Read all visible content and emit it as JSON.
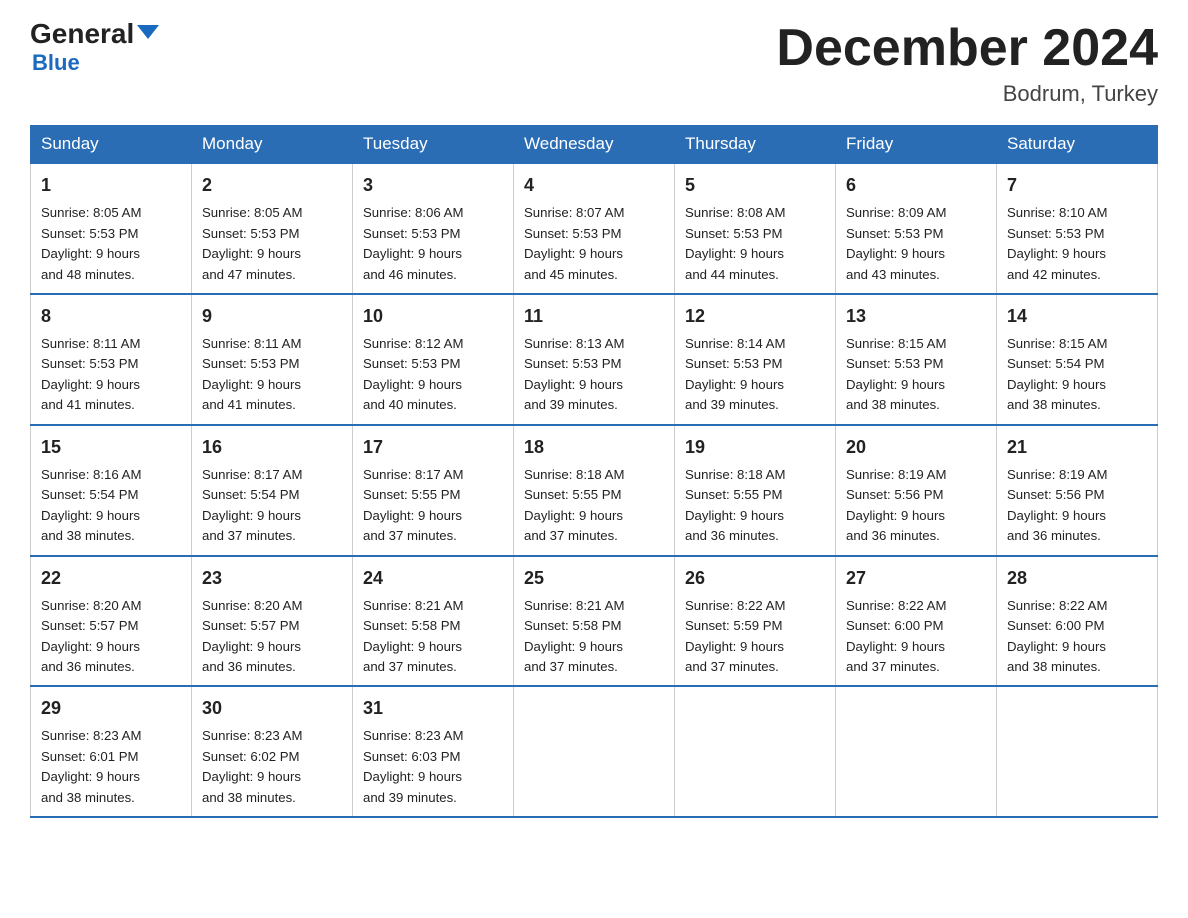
{
  "header": {
    "logo_general": "General",
    "logo_blue": "Blue",
    "month_title": "December 2024",
    "location": "Bodrum, Turkey"
  },
  "days_of_week": [
    "Sunday",
    "Monday",
    "Tuesday",
    "Wednesday",
    "Thursday",
    "Friday",
    "Saturday"
  ],
  "weeks": [
    [
      {
        "day": "1",
        "sunrise": "8:05 AM",
        "sunset": "5:53 PM",
        "daylight": "9 hours and 48 minutes."
      },
      {
        "day": "2",
        "sunrise": "8:05 AM",
        "sunset": "5:53 PM",
        "daylight": "9 hours and 47 minutes."
      },
      {
        "day": "3",
        "sunrise": "8:06 AM",
        "sunset": "5:53 PM",
        "daylight": "9 hours and 46 minutes."
      },
      {
        "day": "4",
        "sunrise": "8:07 AM",
        "sunset": "5:53 PM",
        "daylight": "9 hours and 45 minutes."
      },
      {
        "day": "5",
        "sunrise": "8:08 AM",
        "sunset": "5:53 PM",
        "daylight": "9 hours and 44 minutes."
      },
      {
        "day": "6",
        "sunrise": "8:09 AM",
        "sunset": "5:53 PM",
        "daylight": "9 hours and 43 minutes."
      },
      {
        "day": "7",
        "sunrise": "8:10 AM",
        "sunset": "5:53 PM",
        "daylight": "9 hours and 42 minutes."
      }
    ],
    [
      {
        "day": "8",
        "sunrise": "8:11 AM",
        "sunset": "5:53 PM",
        "daylight": "9 hours and 41 minutes."
      },
      {
        "day": "9",
        "sunrise": "8:11 AM",
        "sunset": "5:53 PM",
        "daylight": "9 hours and 41 minutes."
      },
      {
        "day": "10",
        "sunrise": "8:12 AM",
        "sunset": "5:53 PM",
        "daylight": "9 hours and 40 minutes."
      },
      {
        "day": "11",
        "sunrise": "8:13 AM",
        "sunset": "5:53 PM",
        "daylight": "9 hours and 39 minutes."
      },
      {
        "day": "12",
        "sunrise": "8:14 AM",
        "sunset": "5:53 PM",
        "daylight": "9 hours and 39 minutes."
      },
      {
        "day": "13",
        "sunrise": "8:15 AM",
        "sunset": "5:53 PM",
        "daylight": "9 hours and 38 minutes."
      },
      {
        "day": "14",
        "sunrise": "8:15 AM",
        "sunset": "5:54 PM",
        "daylight": "9 hours and 38 minutes."
      }
    ],
    [
      {
        "day": "15",
        "sunrise": "8:16 AM",
        "sunset": "5:54 PM",
        "daylight": "9 hours and 38 minutes."
      },
      {
        "day": "16",
        "sunrise": "8:17 AM",
        "sunset": "5:54 PM",
        "daylight": "9 hours and 37 minutes."
      },
      {
        "day": "17",
        "sunrise": "8:17 AM",
        "sunset": "5:55 PM",
        "daylight": "9 hours and 37 minutes."
      },
      {
        "day": "18",
        "sunrise": "8:18 AM",
        "sunset": "5:55 PM",
        "daylight": "9 hours and 37 minutes."
      },
      {
        "day": "19",
        "sunrise": "8:18 AM",
        "sunset": "5:55 PM",
        "daylight": "9 hours and 36 minutes."
      },
      {
        "day": "20",
        "sunrise": "8:19 AM",
        "sunset": "5:56 PM",
        "daylight": "9 hours and 36 minutes."
      },
      {
        "day": "21",
        "sunrise": "8:19 AM",
        "sunset": "5:56 PM",
        "daylight": "9 hours and 36 minutes."
      }
    ],
    [
      {
        "day": "22",
        "sunrise": "8:20 AM",
        "sunset": "5:57 PM",
        "daylight": "9 hours and 36 minutes."
      },
      {
        "day": "23",
        "sunrise": "8:20 AM",
        "sunset": "5:57 PM",
        "daylight": "9 hours and 36 minutes."
      },
      {
        "day": "24",
        "sunrise": "8:21 AM",
        "sunset": "5:58 PM",
        "daylight": "9 hours and 37 minutes."
      },
      {
        "day": "25",
        "sunrise": "8:21 AM",
        "sunset": "5:58 PM",
        "daylight": "9 hours and 37 minutes."
      },
      {
        "day": "26",
        "sunrise": "8:22 AM",
        "sunset": "5:59 PM",
        "daylight": "9 hours and 37 minutes."
      },
      {
        "day": "27",
        "sunrise": "8:22 AM",
        "sunset": "6:00 PM",
        "daylight": "9 hours and 37 minutes."
      },
      {
        "day": "28",
        "sunrise": "8:22 AM",
        "sunset": "6:00 PM",
        "daylight": "9 hours and 38 minutes."
      }
    ],
    [
      {
        "day": "29",
        "sunrise": "8:23 AM",
        "sunset": "6:01 PM",
        "daylight": "9 hours and 38 minutes."
      },
      {
        "day": "30",
        "sunrise": "8:23 AM",
        "sunset": "6:02 PM",
        "daylight": "9 hours and 38 minutes."
      },
      {
        "day": "31",
        "sunrise": "8:23 AM",
        "sunset": "6:03 PM",
        "daylight": "9 hours and 39 minutes."
      },
      null,
      null,
      null,
      null
    ]
  ],
  "labels": {
    "sunrise": "Sunrise:",
    "sunset": "Sunset:",
    "daylight": "Daylight:"
  }
}
